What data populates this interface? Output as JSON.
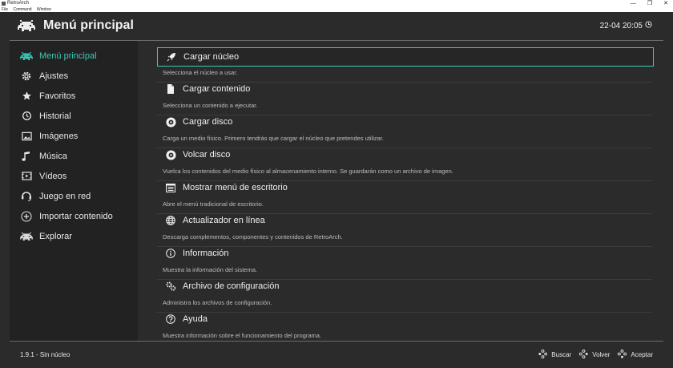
{
  "window": {
    "title": "RetroArch",
    "menu": [
      "File",
      "Command",
      "Window"
    ],
    "controls": [
      "—",
      "❐",
      "✕"
    ]
  },
  "header": {
    "title": "Menú principal",
    "clock": "22-04 20:05"
  },
  "sidebar": {
    "items": [
      {
        "label": "Menú principal",
        "icon": "invader-icon"
      },
      {
        "label": "Ajustes",
        "icon": "gear-icon"
      },
      {
        "label": "Favoritos",
        "icon": "star-icon"
      },
      {
        "label": "Historial",
        "icon": "history-icon"
      },
      {
        "label": "Imágenes",
        "icon": "image-icon"
      },
      {
        "label": "Música",
        "icon": "music-icon"
      },
      {
        "label": "Vídeos",
        "icon": "video-icon"
      },
      {
        "label": "Juego en red",
        "icon": "netplay-icon"
      },
      {
        "label": "Importar contenido",
        "icon": "plus-icon"
      },
      {
        "label": "Explorar",
        "icon": "invader-icon"
      }
    ]
  },
  "menu": {
    "entries": [
      {
        "label": "Cargar núcleo",
        "desc": "Selecciona el núcleo a usar.",
        "icon": "rocket-icon"
      },
      {
        "label": "Cargar contenido",
        "desc": "Selecciona un contenido a ejecutar.",
        "icon": "file-icon"
      },
      {
        "label": "Cargar disco",
        "desc": "Carga un medio físico. Primero tendrás que cargar el núcleo que pretendes utilizar.",
        "icon": "disc-icon"
      },
      {
        "label": "Volcar disco",
        "desc": "Vuelca los contenidos del medio físico al almacenamiento interno. Se guardarán como un archivo de imagen.",
        "icon": "disc-icon"
      },
      {
        "label": "Mostrar menú de escritorio",
        "desc": "Abre el menú tradicional de escritorio.",
        "icon": "desktop-menu-icon"
      },
      {
        "label": "Actualizador en línea",
        "desc": "Descarga complementos, componentes y contenidos de RetroArch.",
        "icon": "globe-icon"
      },
      {
        "label": "Información",
        "desc": "Muestra la información del sistema.",
        "icon": "info-icon"
      },
      {
        "label": "Archivo de configuración",
        "desc": "Administra los archivos de configuración.",
        "icon": "settings-file-icon"
      },
      {
        "label": "Ayuda",
        "desc": "Muestra información sobre el funcionamiento del programa.",
        "icon": "help-icon"
      }
    ]
  },
  "footer": {
    "version": "1.9.1 - Sin núcleo",
    "actions": [
      "Buscar",
      "Volver",
      "Aceptar"
    ]
  },
  "colors": {
    "accent": "#3ec8b8",
    "background": "#2b2b2b",
    "sidebar": "#222222"
  }
}
